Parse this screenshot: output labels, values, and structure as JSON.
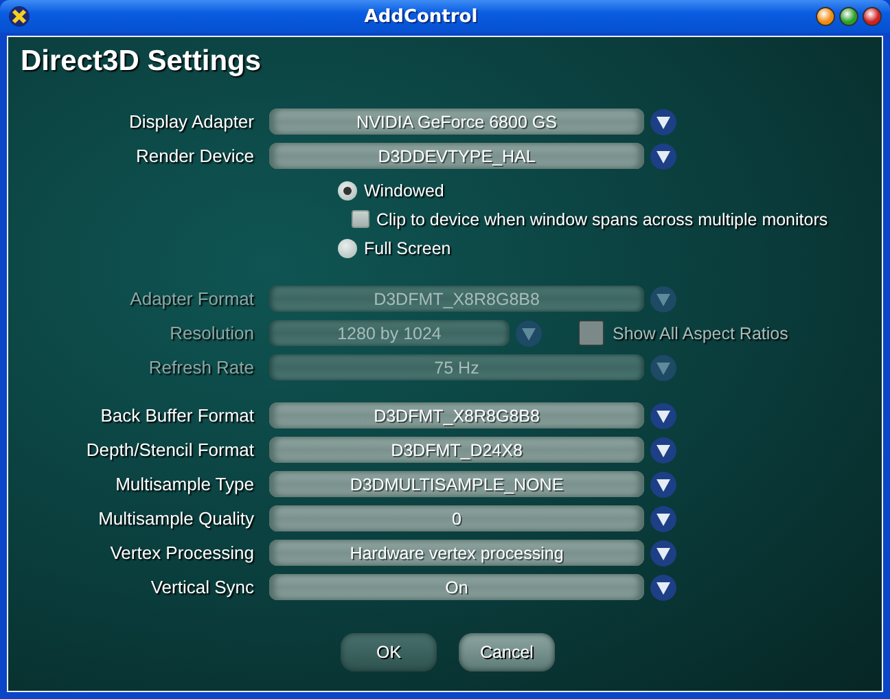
{
  "window": {
    "title": "AddControl"
  },
  "heading": "Direct3D Settings",
  "sections": [
    {
      "kind": "dropdowns",
      "rows": [
        {
          "label": "Display Adapter",
          "value": "NVIDIA GeForce 6800 GS",
          "disabled": false
        },
        {
          "label": "Render Device",
          "value": "D3DDEVTYPE_HAL",
          "disabled": false
        }
      ]
    },
    {
      "kind": "mode",
      "options": [
        {
          "kind": "radio",
          "label": "Windowed",
          "selected": true
        },
        {
          "kind": "checkbox",
          "label": "Clip to device when window spans across multiple monitors",
          "checked": false
        },
        {
          "kind": "radio",
          "label": "Full Screen",
          "selected": false
        }
      ]
    },
    {
      "kind": "dropdowns",
      "rows": [
        {
          "label": "Adapter Format",
          "value": "D3DFMT_X8R8G8B8",
          "disabled": true
        },
        {
          "label": "Resolution",
          "value": "1280 by 1024",
          "disabled": true,
          "checkbox": {
            "label": "Show All Aspect Ratios",
            "checked": false
          }
        },
        {
          "label": "Refresh Rate",
          "value": "75 Hz",
          "disabled": true
        }
      ]
    },
    {
      "kind": "dropdowns",
      "rows": [
        {
          "label": "Back Buffer Format",
          "value": "D3DFMT_X8R8G8B8",
          "disabled": false
        },
        {
          "label": "Depth/Stencil Format",
          "value": "D3DFMT_D24X8",
          "disabled": false
        },
        {
          "label": "Multisample Type",
          "value": "D3DMULTISAMPLE_NONE",
          "disabled": false
        },
        {
          "label": "Multisample Quality",
          "value": "0",
          "disabled": false
        },
        {
          "label": "Vertex Processing",
          "value": "Hardware vertex processing",
          "disabled": false
        },
        {
          "label": "Vertical Sync",
          "value": "On",
          "disabled": false
        }
      ]
    }
  ],
  "buttons": [
    "OK",
    "Cancel"
  ]
}
